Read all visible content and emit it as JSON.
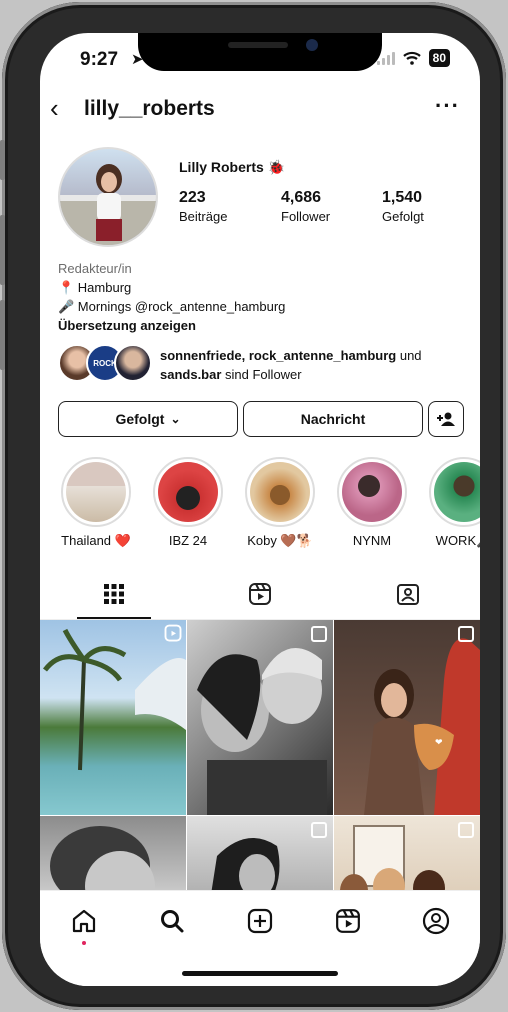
{
  "status": {
    "time": "9:27",
    "battery": "80"
  },
  "header": {
    "username": "lilly__roberts",
    "more_label": "···"
  },
  "profile": {
    "name": "Lilly Roberts",
    "stats": [
      {
        "value": "223",
        "label": "Beiträge"
      },
      {
        "value": "4,686",
        "label": "Follower"
      },
      {
        "value": "1,540",
        "label": "Gefolgt"
      }
    ],
    "category": "Redakteur/in",
    "bio_lines": [
      "📍 Hamburg",
      "🎤 Mornings @rock_antenne_hamburg"
    ],
    "translate": "Übersetzung anzeigen"
  },
  "followed_by": {
    "names": "sonnenfriede, rock_antenne_hamburg",
    "und": " und",
    "name3": "sands.bar",
    "suffix": " sind Follower"
  },
  "actions": {
    "following": "Gefolgt",
    "message": "Nachricht"
  },
  "highlights": [
    {
      "label": "Thailand ❤️"
    },
    {
      "label": "IBZ 24"
    },
    {
      "label": "Koby 🤎🐕"
    },
    {
      "label": "NYNM"
    },
    {
      "label": "WORK🎤"
    }
  ],
  "icons": {
    "grid": "grid-icon",
    "reels": "reels-icon",
    "tagged": "tagged-icon"
  }
}
